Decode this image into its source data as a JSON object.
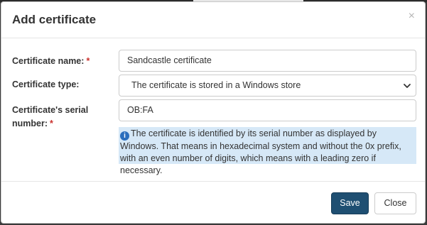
{
  "dialog": {
    "title": "Add certificate",
    "close_glyph": "×"
  },
  "form": {
    "name": {
      "label": "Certificate name:",
      "required_mark": "*",
      "value": "Sandcastle certificate"
    },
    "type": {
      "label": "Certificate type:",
      "selected": "The certificate is stored in a Windows store"
    },
    "serial": {
      "label_line1": "Certificate's serial",
      "label_line2": "number:",
      "required_mark": "*",
      "value": "OB:FA"
    },
    "info": {
      "icon": "info-icon",
      "icon_glyph": "i",
      "text": "The certificate is identified by its serial number as displayed by Windows. That means in hexadecimal system and without the 0x prefix, with an even number of digits, which means with a leading zero if necessary."
    }
  },
  "footer": {
    "save_label": "Save",
    "close_label": "Close"
  },
  "colors": {
    "primary_button": "#1f4f72",
    "required": "#c9302c",
    "info_background": "#d6e8f7",
    "info_icon": "#2a6ebd"
  }
}
